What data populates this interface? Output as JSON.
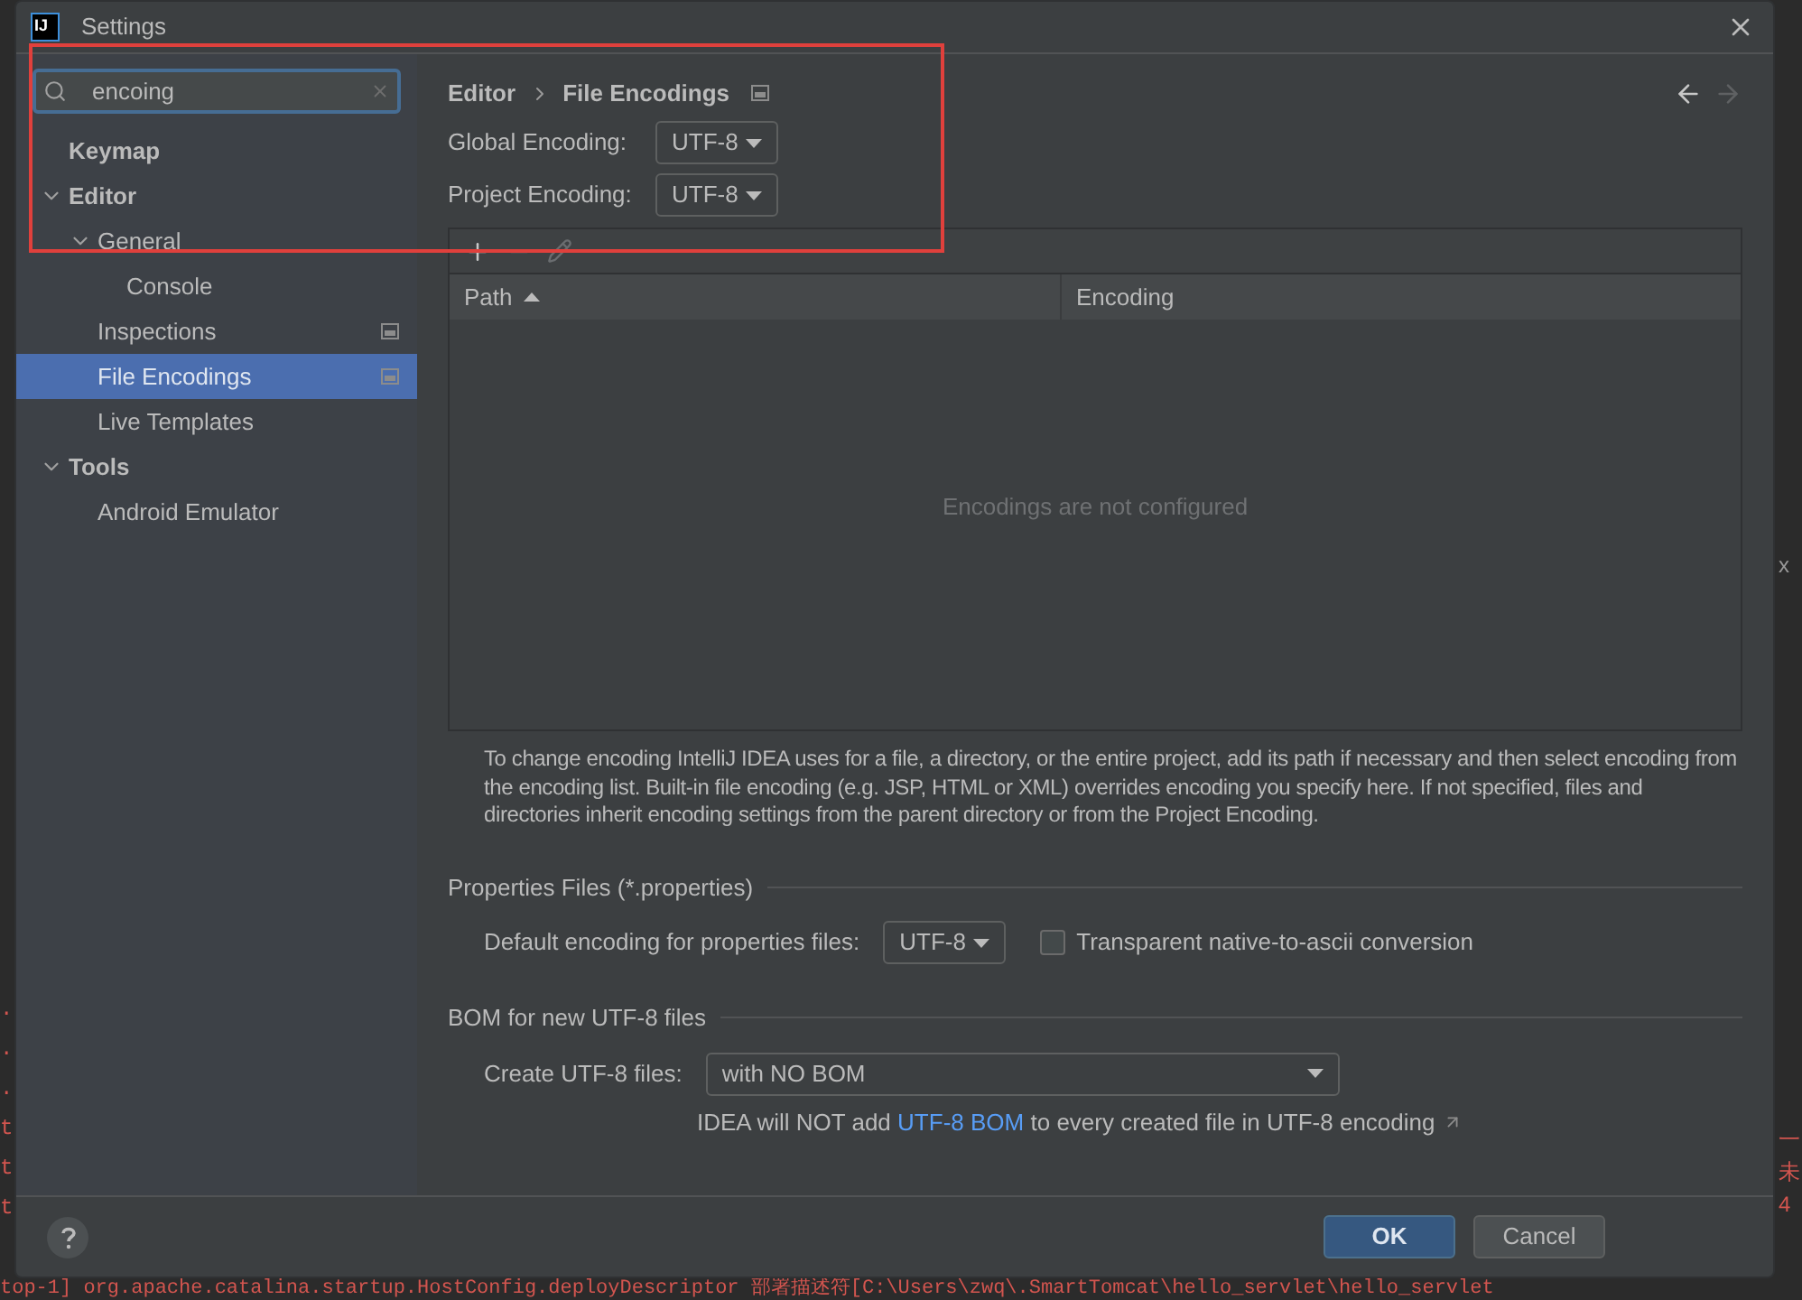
{
  "background_console": {
    "left_fragments": [
      ".",
      ".",
      ".",
      "t",
      "t",
      "t"
    ],
    "right_fragments": [
      {
        "text": "x",
        "kind": "plain"
      },
      {
        "text": "一",
        "kind": "error"
      },
      {
        "text": "未",
        "kind": "error"
      },
      {
        "text": "4",
        "kind": "error"
      }
    ],
    "bottom_line": "top-1] org.apache.catalina.startup.HostConfig.deployDescriptor 部署描述符[C:\\Users\\zwq\\.SmartTomcat\\hello_servlet\\hello_servlet"
  },
  "window": {
    "logo": "IJ",
    "title": "Settings"
  },
  "search": {
    "value": "encoing"
  },
  "sidebar": {
    "items": [
      {
        "label": "Keymap",
        "selected": false,
        "project_level": false
      },
      {
        "label": "Editor",
        "selected": false,
        "project_level": false,
        "expanded": true,
        "children": [
          {
            "label": "General",
            "selected": false,
            "project_level": false,
            "expanded": true,
            "children": [
              {
                "label": "Console",
                "selected": false,
                "project_level": false
              }
            ]
          },
          {
            "label": "Inspections",
            "selected": false,
            "project_level": true
          },
          {
            "label": "File Encodings",
            "selected": true,
            "project_level": true
          },
          {
            "label": "Live Templates",
            "selected": false,
            "project_level": false
          }
        ]
      },
      {
        "label": "Tools",
        "selected": false,
        "project_level": false,
        "expanded": true,
        "children": [
          {
            "label": "Android Emulator",
            "selected": false,
            "project_level": false
          }
        ]
      }
    ]
  },
  "breadcrumb": [
    "Editor",
    "File Encodings"
  ],
  "nav": {
    "back_disabled": false,
    "forward_disabled": true
  },
  "encodings": [
    {
      "label": "Global Encoding:",
      "value": "UTF-8"
    },
    {
      "label": "Project Encoding:",
      "value": "UTF-8"
    }
  ],
  "table": {
    "toolbar": [
      {
        "kind": "add",
        "disabled": false
      },
      {
        "kind": "remove",
        "disabled": true
      },
      {
        "kind": "edit",
        "disabled": true
      }
    ],
    "columns": [
      {
        "label": "Path",
        "sorted": true
      },
      {
        "label": "Encoding",
        "sorted": false
      }
    ],
    "empty_text": "Encodings are not configured"
  },
  "help_text": "To change encoding IntelliJ IDEA uses for a file, a directory, or the entire project, add its path if necessary and then select encoding from the encoding list. Built-in file encoding (e.g. JSP, HTML or XML) overrides encoding you specify here. If not specified, files and directories inherit encoding settings from the parent directory or from the Project Encoding.",
  "properties_section": {
    "title": "Properties Files (*.properties)",
    "label": "Default encoding for properties files:",
    "value": "UTF-8",
    "checkbox": {
      "label": "Transparent native-to-ascii conversion",
      "checked": false
    }
  },
  "bom_section": {
    "title": "BOM for new UTF-8 files",
    "label": "Create UTF-8 files:",
    "value": "with NO BOM",
    "note_before": "IDEA will NOT add",
    "note_link": "UTF-8 BOM",
    "note_after": "to every created file in UTF-8 encoding"
  },
  "buttons": [
    {
      "label": "OK",
      "kind": "primary"
    },
    {
      "label": "Cancel",
      "kind": "secondary"
    }
  ]
}
